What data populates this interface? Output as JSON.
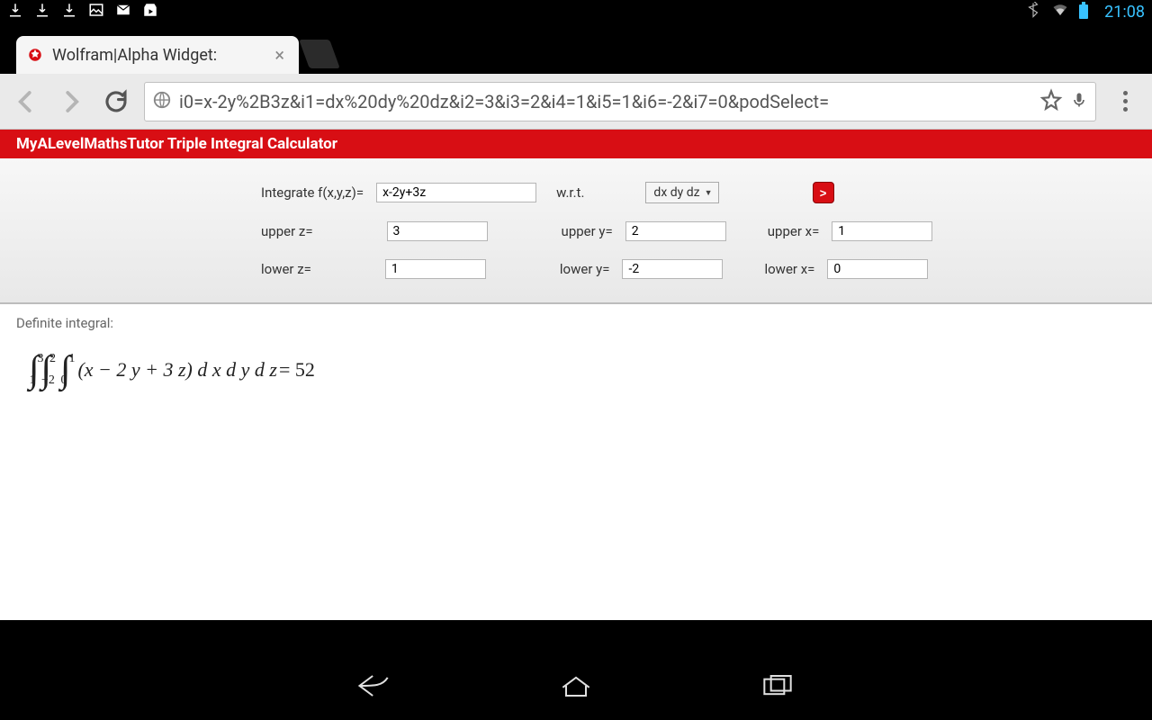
{
  "statusbar": {
    "clock": "21:08"
  },
  "tab": {
    "title": "Wolfram|Alpha Widget:"
  },
  "url": "i0=x-2y%2B3z&i1=dx%20dy%20dz&i2=3&i3=2&i4=1&i5=1&i6=-2&i7=0&podSelect=",
  "header": {
    "title": "MyALevelMathsTutor Triple Integral Calculator"
  },
  "form": {
    "integrate_label": "Integrate f(x,y,z)=",
    "function": "x-2y+3z",
    "wrt_label": "w.r.t.",
    "wrt_value": "dx dy dz",
    "go": ">",
    "upper_z_label": "upper z=",
    "upper_z": "3",
    "upper_y_label": "upper y=",
    "upper_y": "2",
    "upper_x_label": "upper x=",
    "upper_x": "1",
    "lower_z_label": "lower z=",
    "lower_z": "1",
    "lower_y_label": "lower y=",
    "lower_y": "-2",
    "lower_x_label": "lower x=",
    "lower_x": "0"
  },
  "result": {
    "label": "Definite integral:",
    "z_lo": "1",
    "z_hi": "3",
    "y_lo": "−2",
    "y_hi": "2",
    "x_lo": "0",
    "x_hi": "1",
    "integrand": "(x − 2 y + 3 z) d x d y d z",
    "equals": " = 52"
  }
}
